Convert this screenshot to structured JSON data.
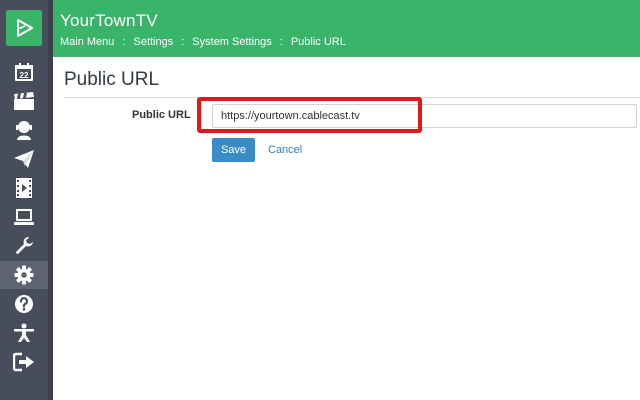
{
  "app": {
    "title": "YourTownTV"
  },
  "breadcrumb": [
    "Main Menu",
    "Settings",
    "System Settings",
    "Public URL"
  ],
  "breadcrumb_separator": ":",
  "page": {
    "title": "Public URL"
  },
  "form": {
    "label": "Public URL",
    "value": "https://yourtown.cablecast.tv",
    "save_label": "Save",
    "cancel_label": "Cancel"
  },
  "calendar_day": "22",
  "sidebar": {
    "items": [
      {
        "icon": "calendar-icon"
      },
      {
        "icon": "clapperboard-icon"
      },
      {
        "icon": "presenter-icon"
      },
      {
        "icon": "paper-plane-icon"
      },
      {
        "icon": "film-play-icon"
      },
      {
        "icon": "laptop-icon"
      },
      {
        "icon": "wrench-icon"
      },
      {
        "icon": "gear-icon",
        "active": true
      },
      {
        "icon": "help-icon"
      },
      {
        "icon": "accessibility-icon"
      },
      {
        "icon": "sign-out-icon"
      }
    ]
  },
  "colors": {
    "header": "#3ab36b",
    "sidebar": "#474d5b",
    "primary_button": "#3a8cc6",
    "highlight": "#e0181b"
  }
}
